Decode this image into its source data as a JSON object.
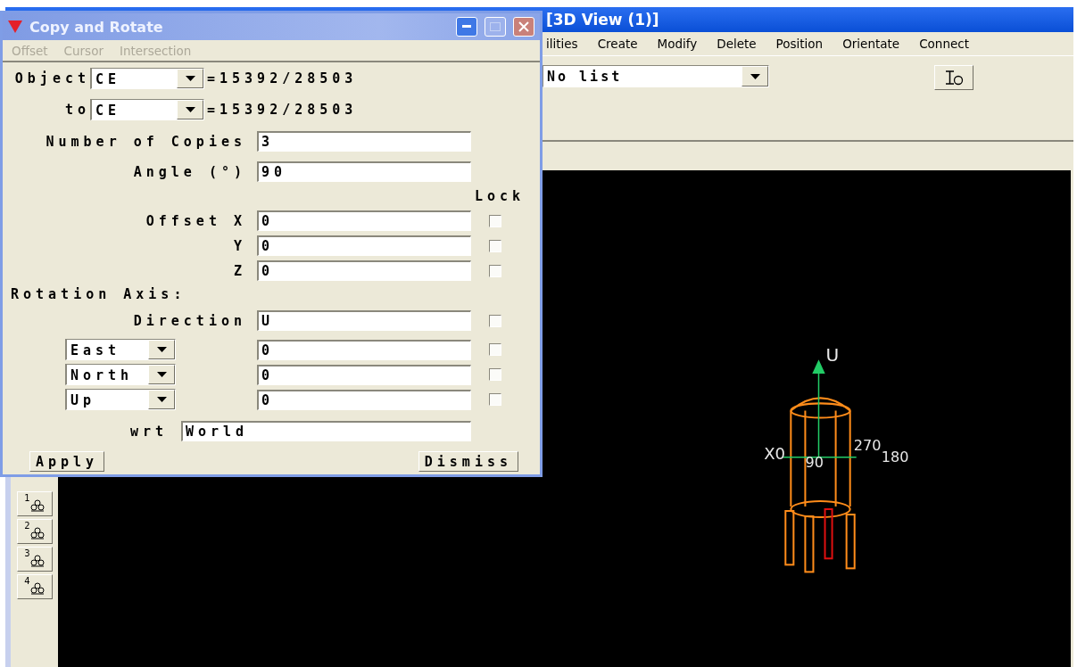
{
  "main_window": {
    "title": "[3D View (1)]",
    "menu": [
      "ilities",
      "Create",
      "Modify",
      "Delete",
      "Position",
      "Orientate",
      "Connect"
    ],
    "list_select": {
      "value": "No list"
    },
    "view_buttons": [
      {
        "number": "1"
      },
      {
        "number": "2"
      },
      {
        "number": "3"
      },
      {
        "number": "4"
      }
    ],
    "viewport": {
      "axis_labels": [
        {
          "kind": "up",
          "text": "U"
        },
        {
          "kind": "x",
          "text": "X0"
        },
        {
          "kind": "a90",
          "text": "90"
        },
        {
          "kind": "a270",
          "text": "270"
        },
        {
          "kind": "a180",
          "text": "180"
        }
      ]
    }
  },
  "dialog": {
    "title": "Copy and Rotate",
    "menu": [
      {
        "label": "Offset",
        "disabled": true
      },
      {
        "label": "Cursor",
        "disabled": true
      },
      {
        "label": "Intersection",
        "disabled": true
      }
    ],
    "object": {
      "label": "Object",
      "value": "CE",
      "reference": "=15392/28503"
    },
    "to": {
      "label": "to",
      "value": "CE",
      "reference": "=15392/28503"
    },
    "copies": {
      "label": "Number of Copies",
      "value": "3"
    },
    "angle": {
      "label": "Angle (°)",
      "value": "90"
    },
    "lock_header": "Lock",
    "offsets": [
      {
        "label": "Offset X",
        "value": "0",
        "locked": false
      },
      {
        "label": "Y",
        "value": "0",
        "locked": false
      },
      {
        "label": "Z",
        "value": "0",
        "locked": false
      }
    ],
    "rotation_axis_heading": "Rotation Axis:",
    "direction": {
      "label": "Direction",
      "value": "U",
      "locked": false
    },
    "components": [
      {
        "axis": "East",
        "value": "0",
        "locked": false
      },
      {
        "axis": "North",
        "value": "0",
        "locked": false
      },
      {
        "axis": "Up",
        "value": "0",
        "locked": false
      }
    ],
    "wrt": {
      "label": "wrt",
      "value": "World"
    },
    "buttons": [
      "Apply",
      "Dismiss"
    ]
  }
}
